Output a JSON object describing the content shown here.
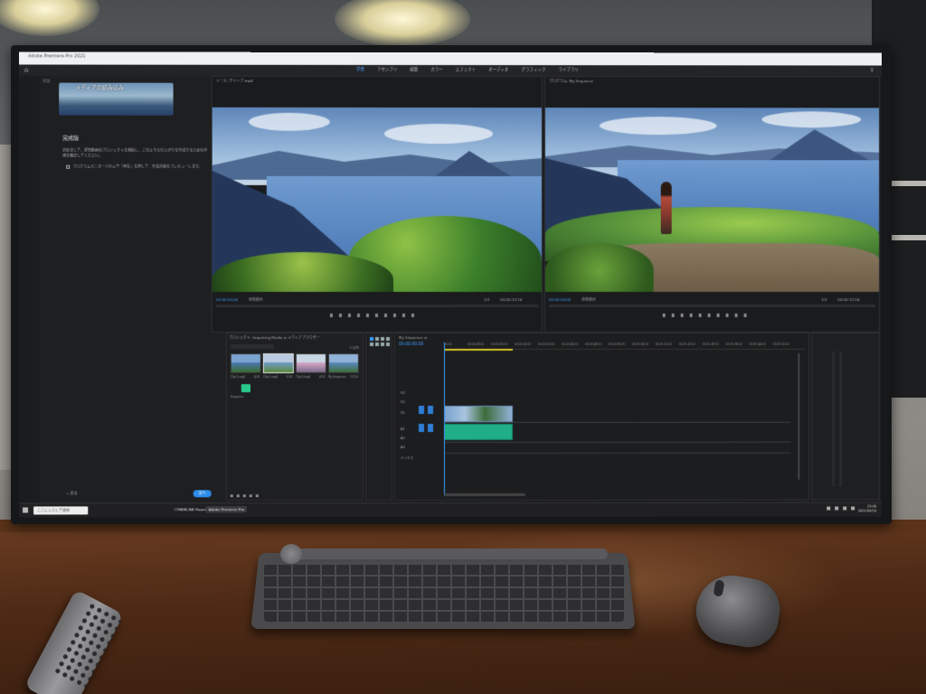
{
  "app": {
    "title": "Adobe Premiere Pro 2021",
    "workspace_tabs": [
      "学習",
      "アセンブリ",
      "編集",
      "カラー",
      "エフェクト",
      "オーディオ",
      "グラフィック",
      "ライブラリ"
    ],
    "active_workspace": "学習"
  },
  "learn_panel": {
    "label": "学習",
    "tutorial_title": "メディアの読み込み",
    "heading": "完成版",
    "body": "初めまして、新規動画のプロジェクトを開始し、このような仕上がりを作成するための手順を確認してください。",
    "step": "プログラムモニターパネルで「再生」を押して、作成内容をプレビューします。",
    "back_label": "< 戻る",
    "next_label": "次へ"
  },
  "source_monitor": {
    "tab": "ソース: クリップ.mp4",
    "timecode_in": "00;00;00;00",
    "fit": "全体表示",
    "full": "1/2",
    "timecode_out": "00;00;12;14"
  },
  "program_monitor": {
    "tab": "プログラム: My Sequence",
    "timecode_in": "00;00;00;00",
    "fit": "全体表示",
    "full": "1/2",
    "timecode_out": "00;00;12;14"
  },
  "project_panel": {
    "tabs": "プロジェクト: Importing Media ≡  メディアブラウザー",
    "search_placeholder": "",
    "count": "5 項目",
    "clips": [
      {
        "name": "Clip 1.mp4",
        "duration": "4;01"
      },
      {
        "name": "Clip 2.mp4",
        "duration": "5;02"
      },
      {
        "name": "Clip 3.mp4",
        "duration": "4;07"
      },
      {
        "name": "My Sequence",
        "duration": "12;14"
      }
    ],
    "sequence_label": "Sequence"
  },
  "timeline": {
    "tab": "My Sequence ≡",
    "timecode": "00;00;00;00",
    "ruler": [
      "00;00",
      "00;00;08;00",
      "00;00;16;00",
      "00;00;24;00",
      "00;00;32;00",
      "00;00;40;00",
      "00;00;48;00",
      "00;00;56;00",
      "00;01;04;02",
      "00;01;12;02",
      "00;01;20;02",
      "00;01;28;02",
      "00;01;36;02",
      "00;01;44;02",
      "00;01;52;02"
    ],
    "tracks": [
      "V3",
      "V2",
      "V1",
      "A1",
      "A2",
      "A3",
      "ミックス"
    ]
  },
  "taskbar": {
    "search": "ここに入力して検索",
    "apps": [
      "CYBERLINK PowerDVD",
      "Adobe Premiere Pro"
    ],
    "time": "21:00",
    "date": "2021/05/10"
  },
  "colors": {
    "accent": "#3d9eff",
    "audio_clip": "#1fae86",
    "workbar": "#d6c62b"
  }
}
